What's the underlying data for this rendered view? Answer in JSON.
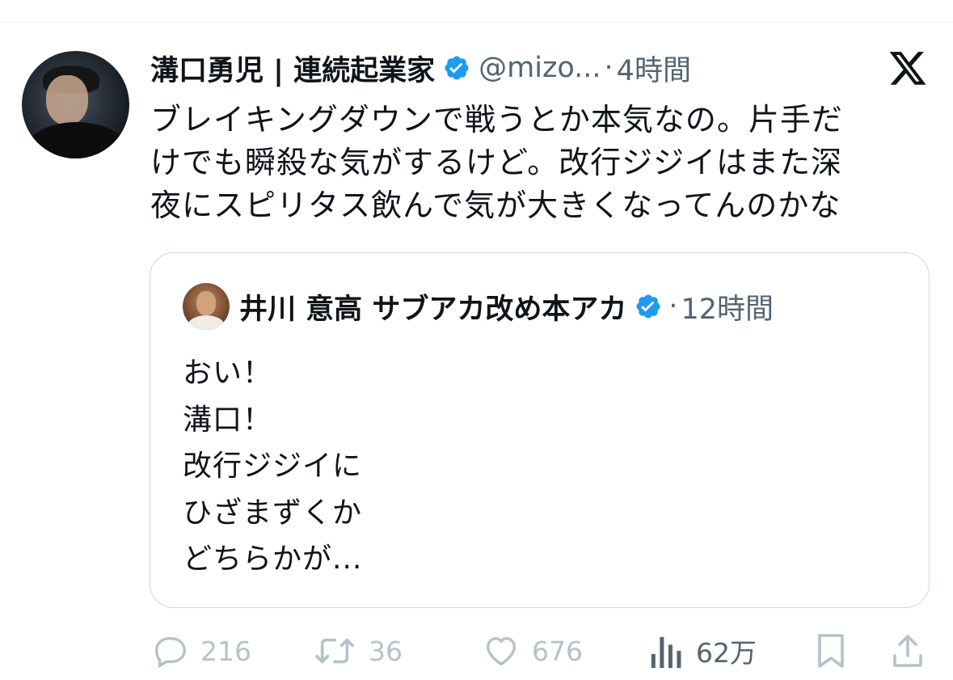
{
  "tweet": {
    "author_name": "溝口勇児 | 連続起業家",
    "handle": "@mizo...",
    "separator": "·",
    "time": "4時間",
    "text_lines": [
      "ブレイキングダウンで戦うとか本気なの。片手だ",
      "けでも瞬殺な気がするけど。改行ジジイはまた深",
      "夜にスピリタス飲んで気が大きくなってんのかな"
    ]
  },
  "quote": {
    "author_name": "井川 意高 サブアカ改め本アカ",
    "separator": "·",
    "time": "12時間",
    "text_lines": [
      "おい！",
      "溝口！",
      "改行ジジイに",
      "ひざまずくか",
      "どちらかが..."
    ]
  },
  "actions": {
    "reply_count": "216",
    "retweet_count": "36",
    "like_count": "676",
    "views_count": "62万"
  },
  "icons": [
    "verified-badge-icon",
    "x-logo-icon",
    "reply-icon",
    "retweet-icon",
    "like-icon",
    "views-icon",
    "bookmark-icon",
    "share-icon"
  ],
  "colors": {
    "verified": "#1d9bf0",
    "muted_text": "#536471",
    "faded_action": "#b6c2ca",
    "border": "#cfd9de"
  }
}
